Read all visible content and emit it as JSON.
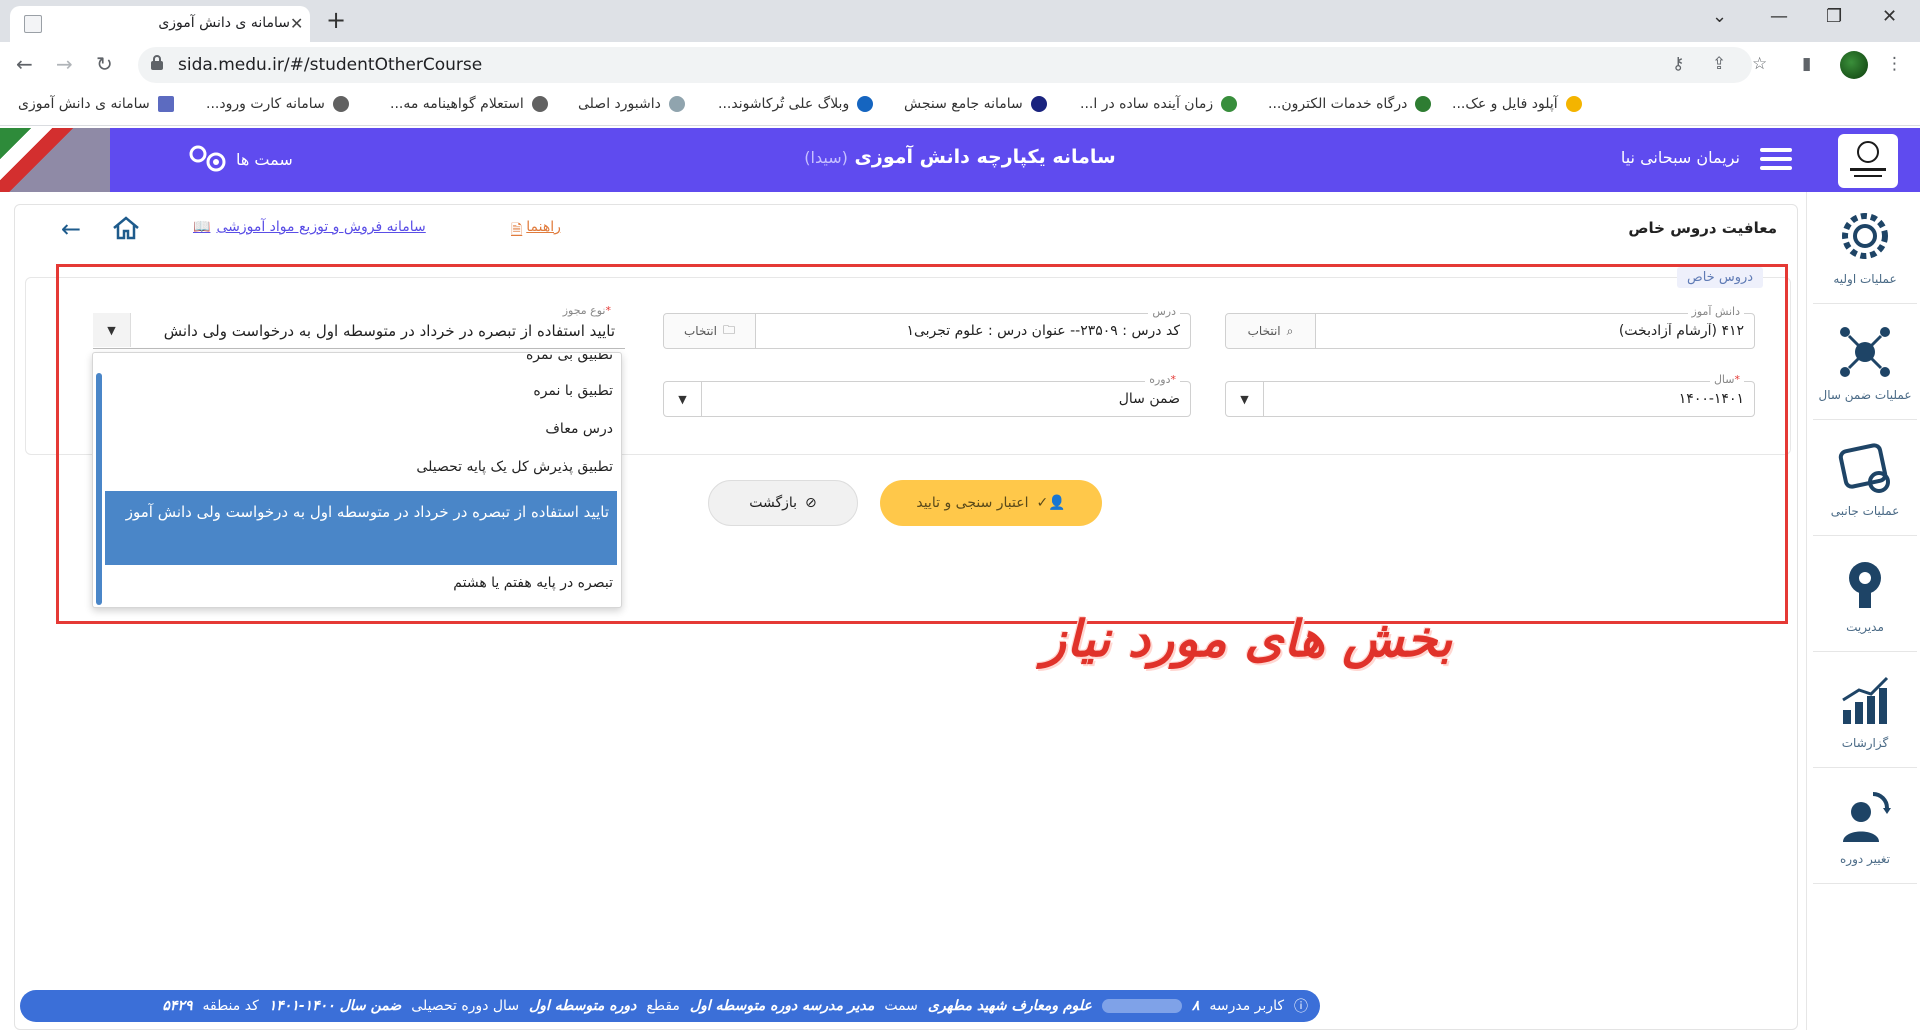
{
  "browser": {
    "tab_title": "سامانه ی دانش آموزی",
    "url": "sida.medu.ir/#/studentOtherCourse",
    "bookmarks": [
      "آپلود فایل و عک...",
      "درگاه خدمات الکترون...",
      "زمان آینده ساده در ا...",
      "سامانه جامع سنجش",
      "وبلاگ علی تُرکاشوند...",
      "داشبورد اصلی",
      "استعلام گواهینامه مه...",
      "سامانه کارت ورود...",
      "سامانه ی دانش آموزی"
    ]
  },
  "header": {
    "app_title": "سامانه یکپارچه دانش آموزی",
    "app_subtitle": "(سیدا)",
    "username": "نریمان سبحانی نیا",
    "roles_label": "سمت ها"
  },
  "sidebar": {
    "items": [
      {
        "label": "عملیات اولیه",
        "icon": "gear-icon"
      },
      {
        "label": "عملیات ضمن سال",
        "icon": "network-gear-icon"
      },
      {
        "label": "عملیات جانبی",
        "icon": "puzzle-icon"
      },
      {
        "label": "مدیریت",
        "icon": "manager-icon"
      },
      {
        "label": "گزارشات",
        "icon": "chart-icon"
      },
      {
        "label": "تغییر دوره",
        "icon": "user-switch-icon"
      }
    ]
  },
  "page": {
    "title": "معافیت دروس خاص",
    "sales_link": "سامانه فروش و توزیع مواد آموزشی",
    "guide_link": "راهنما",
    "section_tag": "دروس خاص"
  },
  "form": {
    "student": {
      "label": "دانش آموز",
      "value": "۴۱۲  (آرشام آزادبخت)",
      "button": "انتخاب"
    },
    "course": {
      "label": "درس",
      "value": "کد درس : ۲۳۵۰۹-- عنوان درس : علوم تجربی۱",
      "button": "انتخاب"
    },
    "permit_type": {
      "label": "نوع مجوز",
      "value": "تایید استفاده از تبصره در خرداد در متوسطه اول به درخواست ولی دانش"
    },
    "year": {
      "label": "سال",
      "value": "۱۴۰۰-۱۴۰۱"
    },
    "term": {
      "label": "دوره",
      "value": "ضمن سال"
    }
  },
  "dropdown": {
    "options": [
      "تطبیق بی نمره",
      "تطبیق با نمره",
      "درس معاف",
      "تطبیق پذیرش کل یک پایه تحصیلی",
      "تایید استفاده از تبصره در خرداد در متوسطه اول به درخواست ولی دانش آموز",
      "تبصره در پایه هفتم یا هشتم"
    ],
    "selected_index": 4
  },
  "buttons": {
    "validate": "اعتبار سنجی و تایید",
    "back": "بازگشت"
  },
  "annotation": "بخش های مورد نیاز",
  "status": {
    "user_label": "کاربر مدرسه",
    "user_prefix": "۸",
    "school": "علوم ومعارف شهید مطهری",
    "role_label": "سمت",
    "role": "مدیر مدرسه دوره متوسطه اول",
    "level_label": "مقطع",
    "level": "دوره متوسطه اول",
    "year_label": "سال دوره تحصیلی",
    "year": "ضمن سال ۱۴۰۰-۱۴۰۱",
    "region_label": "کد منطقه",
    "region": "۵۴۲۹"
  },
  "colors": {
    "header": "#5f4bef",
    "status_bar": "#3b6fd8",
    "validate_button": "#ffc84a",
    "annotation": "#e53935",
    "dropdown_selected": "#4a86c8"
  }
}
